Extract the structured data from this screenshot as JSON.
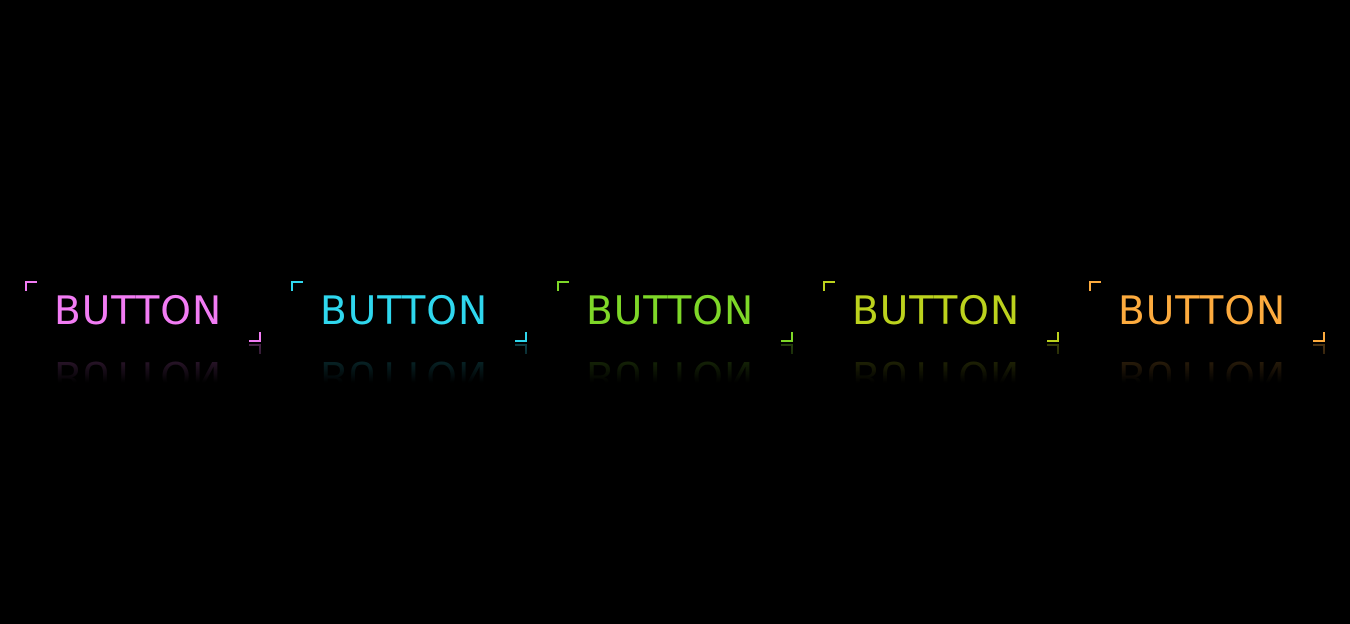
{
  "buttons": [
    {
      "label": "BUTTON",
      "color": "#f27cf4"
    },
    {
      "label": "BUTTON",
      "color": "#2fd7ee"
    },
    {
      "label": "BUTTON",
      "color": "#7ed728"
    },
    {
      "label": "BUTTON",
      "color": "#bcd21d"
    },
    {
      "label": "BUTTON",
      "color": "#fdab3e"
    }
  ]
}
